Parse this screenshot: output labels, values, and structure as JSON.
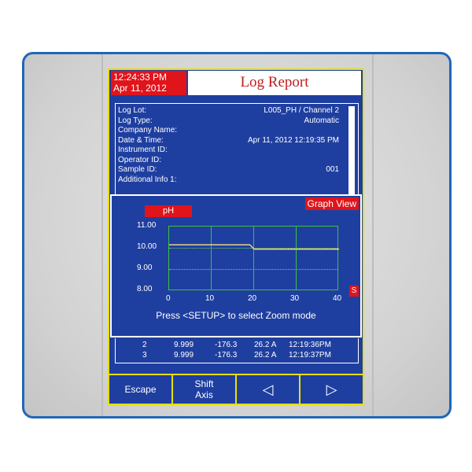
{
  "header": {
    "time": "12:24:33 PM",
    "date": "Apr 11, 2012",
    "title": "Log Report"
  },
  "info": [
    {
      "label": "Log Lot:",
      "value": "L005_PH / Channel 2"
    },
    {
      "label": "Log Type:",
      "value": "Automatic"
    },
    {
      "label": "Company Name:",
      "value": ""
    },
    {
      "label": "Date & Time:",
      "value": "Apr 11, 2012  12:19:35 PM"
    },
    {
      "label": "Instrument ID:",
      "value": ""
    },
    {
      "label": "Operator ID:",
      "value": ""
    },
    {
      "label": "Sample ID:",
      "value": "001"
    },
    {
      "label": "Additional Info 1:",
      "value": ""
    }
  ],
  "graph": {
    "button_label": "Graph View",
    "y_label": "pH",
    "y_ticks": [
      "11.00",
      "10.00",
      "9.00",
      "8.00"
    ],
    "x_ticks": [
      "0",
      "10",
      "20",
      "30",
      "40"
    ],
    "x_unit": "S",
    "instruction": "Press <SETUP> to select Zoom mode"
  },
  "chart_data": {
    "type": "line",
    "xlim": [
      0,
      40
    ],
    "ylim": [
      8,
      11
    ],
    "series": [
      {
        "x": [
          0,
          19,
          20,
          40
        ],
        "y": [
          10.15,
          10.15,
          9.95,
          9.95
        ]
      }
    ],
    "colors": {
      "line": "#ffe07a",
      "grid": "#3fbf3f"
    }
  },
  "readings": [
    {
      "id": "2",
      "ph": "9.999",
      "mv": "-176.3",
      "temp": "26.2 A",
      "time": "12:19:36PM"
    },
    {
      "id": "3",
      "ph": "9.999",
      "mv": "-176.3",
      "temp": "26.2 A",
      "time": "12:19:37PM"
    }
  ],
  "softkeys": {
    "escape": "Escape",
    "shift_axis_line1": "Shift",
    "shift_axis_line2": "Axis",
    "left_icon": "triangle-left-icon",
    "left_glyph": "◁",
    "right_icon": "triangle-right-icon",
    "right_glyph": "▷"
  }
}
